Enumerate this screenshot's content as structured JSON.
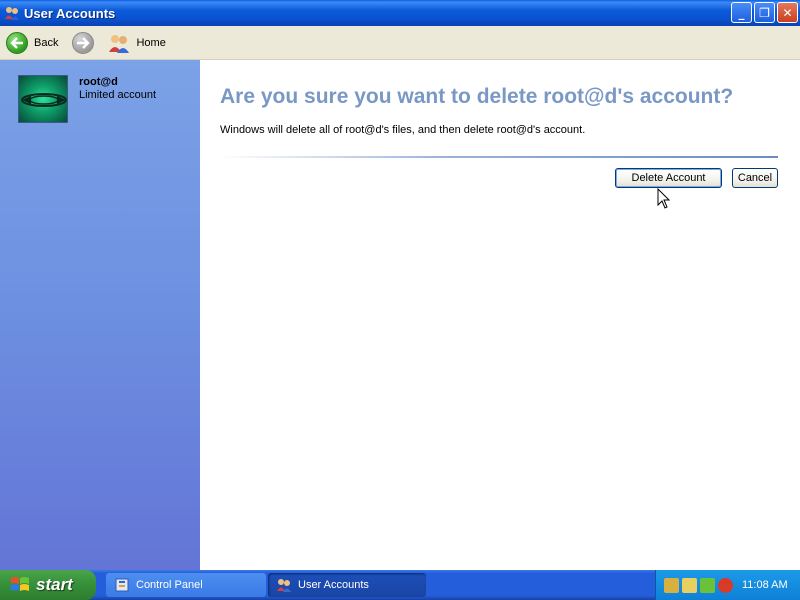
{
  "window": {
    "title": "User Accounts",
    "controls": {
      "minimize": "_",
      "maximize": "❐",
      "close": "✕"
    }
  },
  "toolbar": {
    "back_label": "Back",
    "home_label": "Home"
  },
  "sidebar": {
    "user_name": "root@d",
    "account_type": "Limited account"
  },
  "main": {
    "heading": "Are you sure you want to delete root@d's account?",
    "description": "Windows will delete all of root@d's files, and then delete root@d's account.",
    "delete_button": "Delete Account",
    "cancel_button": "Cancel"
  },
  "taskbar": {
    "start_label": "start",
    "tasks": [
      {
        "label": "Control Panel",
        "active": false
      },
      {
        "label": "User Accounts",
        "active": true
      }
    ],
    "clock": "11:08 AM"
  },
  "icons": {
    "app": "users-icon",
    "back": "back-arrow-icon",
    "forward": "forward-arrow-icon",
    "home": "users-home-icon"
  },
  "colors": {
    "titlebar": "#0a53d0",
    "sidebar": "#6d8fe0",
    "heading": "#7a98c6",
    "start": "#38933b",
    "taskbar": "#245edb"
  }
}
